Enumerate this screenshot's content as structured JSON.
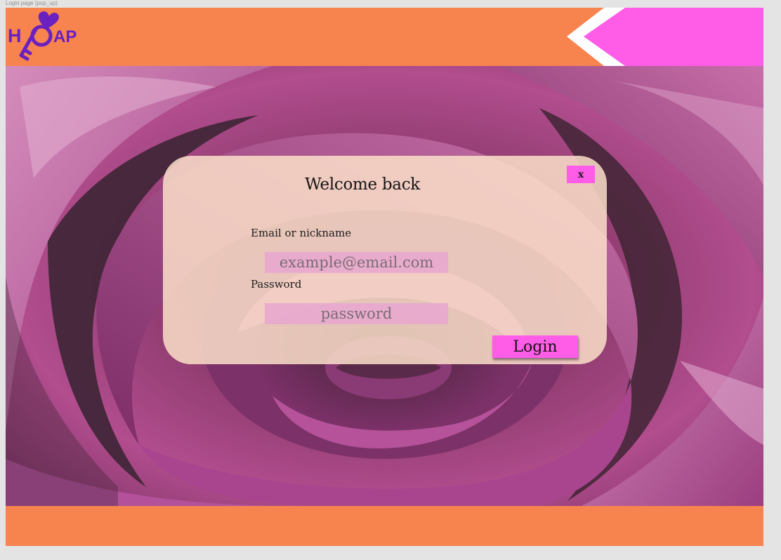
{
  "frame_caption": "Login page (pop_up)",
  "brand": {
    "logo_text_left": "H",
    "logo_text_right": "AP",
    "logo_icon": "heart-key-icon",
    "logo_color": "#6b20c0"
  },
  "colors": {
    "header_bg": "#f7834f",
    "footer_bg": "#f7834f",
    "accent_pink": "#ff5ce8",
    "modal_bg": "#fadec8",
    "input_bg": "#e8aacd"
  },
  "modal": {
    "title": "Welcome back",
    "close_label": "x",
    "email_label": "Email or nickname",
    "email_placeholder": "example@email.com",
    "password_label": "Password",
    "password_placeholder": "password",
    "login_label": "Login"
  }
}
